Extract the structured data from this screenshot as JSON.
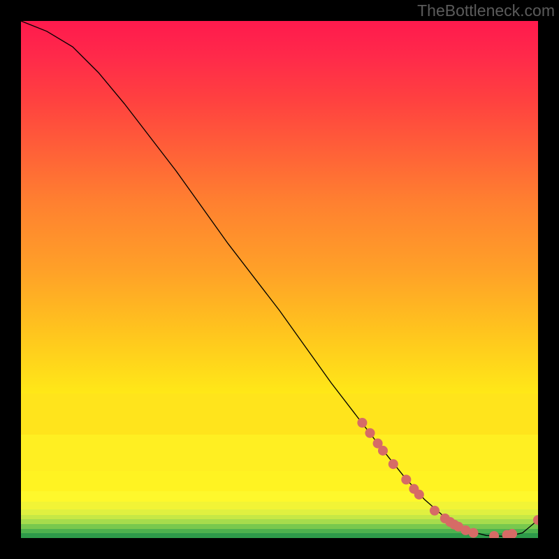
{
  "watermark": "TheBottleneck.com",
  "chart_data": {
    "type": "line",
    "title": "",
    "xlabel": "",
    "ylabel": "",
    "xlim": [
      0,
      100
    ],
    "ylim": [
      0,
      100
    ],
    "grid": false,
    "legend": false,
    "series": [
      {
        "name": "curve",
        "color": "#000000",
        "x": [
          0,
          5,
          10,
          15,
          20,
          25,
          30,
          35,
          40,
          45,
          50,
          55,
          60,
          65,
          70,
          74,
          78,
          82,
          86,
          90,
          94,
          97,
          100
        ],
        "y": [
          100,
          98,
          95,
          90,
          84,
          77.5,
          71,
          64,
          57,
          50.5,
          44,
          37,
          30,
          23.5,
          17,
          12,
          7.5,
          4,
          1.5,
          0.5,
          0.3,
          1,
          3.5
        ]
      }
    ],
    "markers": {
      "name": "highlight-points",
      "color": "#d66b66",
      "radius_pct": 0.95,
      "points": [
        {
          "x": 66.0,
          "y": 22.3
        },
        {
          "x": 67.5,
          "y": 20.3
        },
        {
          "x": 69.0,
          "y": 18.3
        },
        {
          "x": 70.0,
          "y": 16.9
        },
        {
          "x": 72.0,
          "y": 14.3
        },
        {
          "x": 74.5,
          "y": 11.3
        },
        {
          "x": 76.0,
          "y": 9.5
        },
        {
          "x": 77.0,
          "y": 8.4
        },
        {
          "x": 80.0,
          "y": 5.3
        },
        {
          "x": 82.0,
          "y": 3.8
        },
        {
          "x": 83.0,
          "y": 3.1
        },
        {
          "x": 83.8,
          "y": 2.6
        },
        {
          "x": 84.6,
          "y": 2.2
        },
        {
          "x": 86.0,
          "y": 1.5
        },
        {
          "x": 87.5,
          "y": 1.0
        },
        {
          "x": 91.5,
          "y": 0.4
        },
        {
          "x": 94.0,
          "y": 0.6
        },
        {
          "x": 95.0,
          "y": 0.8
        },
        {
          "x": 100.0,
          "y": 3.5
        }
      ]
    },
    "background_bands": [
      {
        "from_y": 0,
        "to_y": 0.9,
        "color": "#2e9a4a"
      },
      {
        "from_y": 0.9,
        "to_y": 1.8,
        "color": "#4eb24e"
      },
      {
        "from_y": 1.8,
        "to_y": 2.7,
        "color": "#78c84e"
      },
      {
        "from_y": 2.7,
        "to_y": 3.6,
        "color": "#a6dc4c"
      },
      {
        "from_y": 3.6,
        "to_y": 4.5,
        "color": "#c6e846"
      },
      {
        "from_y": 4.5,
        "to_y": 5.5,
        "color": "#e0f040"
      },
      {
        "from_y": 5.5,
        "to_y": 7.0,
        "color": "#f2f436"
      },
      {
        "from_y": 7.0,
        "to_y": 9.0,
        "color": "#fef82c"
      },
      {
        "from_y": 9.0,
        "to_y": 13.0,
        "color": "#fff322"
      },
      {
        "from_y": 13.0,
        "to_y": 20.0,
        "color": "#ffef22"
      },
      {
        "from_y": 20.0,
        "to_y": 28.0,
        "color": "#ffe41c"
      }
    ]
  }
}
